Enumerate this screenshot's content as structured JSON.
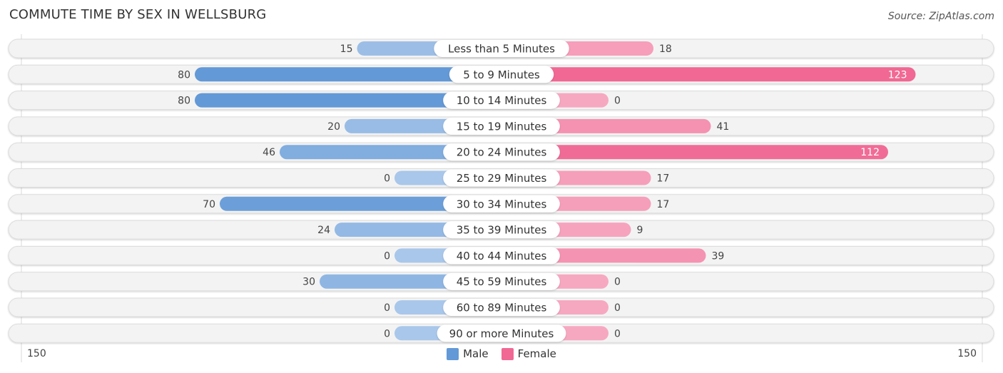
{
  "header": {
    "title": "COMMUTE TIME BY SEX IN WELLSBURG",
    "source": "Source: ZipAtlas.com"
  },
  "colors": {
    "male_strong": "#6399d6",
    "male_light": "#a9c7ea",
    "female_strong": "#f06893",
    "female_light": "#f7a8c1",
    "track": "#f3f3f3",
    "track_border": "#dcdcdc"
  },
  "legend": {
    "male_label": "Male",
    "female_label": "Female"
  },
  "axis": {
    "left_label": "150",
    "right_label": "150"
  },
  "chart_data": {
    "type": "bar",
    "orientation": "horizontal-diverging",
    "title": "COMMUTE TIME BY SEX IN WELLSBURG",
    "xlabel": "",
    "ylabel": "",
    "xlim": [
      -150,
      150
    ],
    "legend_position": "bottom-center",
    "categories": [
      "Less than 5 Minutes",
      "5 to 9 Minutes",
      "10 to 14 Minutes",
      "15 to 19 Minutes",
      "20 to 24 Minutes",
      "25 to 29 Minutes",
      "30 to 34 Minutes",
      "35 to 39 Minutes",
      "40 to 44 Minutes",
      "45 to 59 Minutes",
      "60 to 89 Minutes",
      "90 or more Minutes"
    ],
    "series": [
      {
        "name": "Male",
        "values": [
          15,
          80,
          80,
          20,
          46,
          0,
          70,
          24,
          0,
          30,
          0,
          0
        ]
      },
      {
        "name": "Female",
        "values": [
          18,
          123,
          0,
          41,
          112,
          17,
          17,
          9,
          39,
          0,
          0,
          0
        ]
      }
    ]
  }
}
